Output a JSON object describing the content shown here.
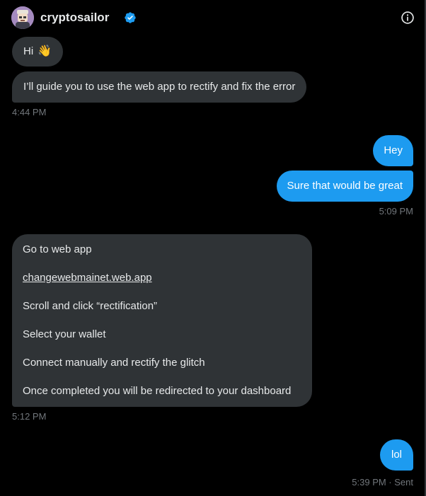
{
  "header": {
    "username": "cryptosailor",
    "verified_icon": "verified-badge-icon",
    "info_icon": "info-icon"
  },
  "colors": {
    "background": "#000000",
    "incoming_bubble": "#2f3336",
    "outgoing_bubble": "#1d9bf0",
    "verified": "#1d9bf0",
    "timestamp": "#71767b"
  },
  "messages": [
    {
      "direction": "in",
      "text": "Hi",
      "emoji": "👋"
    },
    {
      "direction": "in",
      "text": "I’ll guide you to use the web app to rectify and fix the error"
    },
    {
      "direction": "in",
      "time": "4:44 PM"
    },
    {
      "direction": "out",
      "text": "Hey"
    },
    {
      "direction": "out",
      "text": "Sure that would be great"
    },
    {
      "direction": "out",
      "time": "5:09 PM"
    },
    {
      "direction": "in",
      "lines": [
        "Go to web app",
        "changewebmainet.web.app",
        "Scroll and click “rectification”",
        "Select your wallet",
        "Connect manually and rectify the glitch",
        "Once completed you will be redirected to your dashboard"
      ],
      "time": "5:12 PM"
    },
    {
      "direction": "out",
      "text": "lol",
      "time": "5:39 PM · Sent"
    }
  ]
}
